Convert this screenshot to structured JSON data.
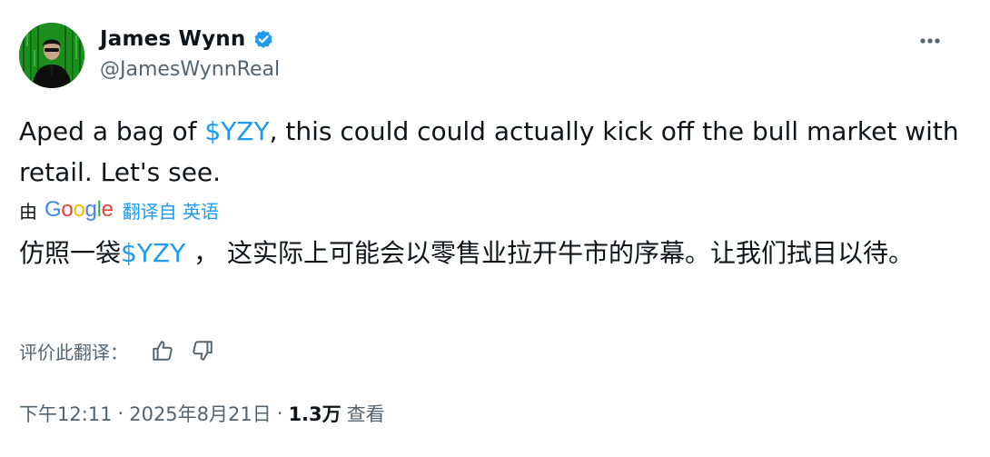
{
  "author": {
    "display_name": "James Wynn",
    "handle": "@JamesWynnReal"
  },
  "icons": {
    "verified": "verified-badge-icon",
    "more": "more-horizontal-icon",
    "thumbs_up": "thumbs-up-icon",
    "thumbs_down": "thumbs-down-icon"
  },
  "tweet": {
    "text_before": "Aped a bag of ",
    "cashtag": "$YZY",
    "text_after": ", this could could actually kick off the bull market with retail. Let's see."
  },
  "translation": {
    "by_label": "由",
    "provider": "Google",
    "from_label": "翻译自 英语",
    "text_before": "仿照一袋",
    "cashtag": "$YZY",
    "text_after": " ， 这实际上可能会以零售业拉开牛市的序幕。让我们拭目以待。",
    "rate_label": "评价此翻译："
  },
  "meta": {
    "time": "下午12:11",
    "separator": "·",
    "date": "2025年8月21日",
    "views_count": "1.3万",
    "views_label": "查看"
  },
  "colors": {
    "link": "#1d9bf0",
    "text": "#0f1419",
    "secondary": "#536471"
  }
}
